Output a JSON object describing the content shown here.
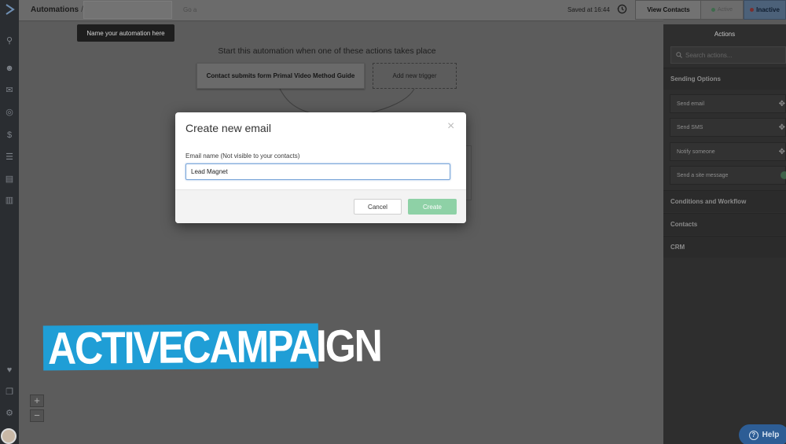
{
  "topbar": {
    "breadcrumb": "Automations",
    "breadcrumb_sep": "/",
    "name_input_value": "",
    "go_label": "Go a",
    "saved_text": "Saved at 16:44",
    "view_contacts_label": "View Contacts",
    "status_active_label": "Active",
    "status_inactive_label": "Inactive",
    "status_active_color": "#3f6b4c",
    "status_inactive_color": "#7a2f2f"
  },
  "canvas": {
    "tooltip": "Name your automation here",
    "start_text": "Start this automation when one of these actions takes place",
    "trigger_label": "Contact submits form Primal Video Method Guide",
    "add_trigger_label": "Add new trigger",
    "zoom_in": "+",
    "zoom_out": "−"
  },
  "panel": {
    "title": "Actions",
    "search_placeholder": "Search actions...",
    "sections": {
      "sending": "Sending Options",
      "conditions": "Conditions and Workflow",
      "contacts": "Contacts",
      "crm": "CRM"
    },
    "items": [
      {
        "label": "Send email",
        "icon": "move-icon"
      },
      {
        "label": "Send SMS",
        "icon": "move-icon"
      },
      {
        "label": "Notify someone",
        "icon": "move-icon"
      },
      {
        "label": "Send a site message",
        "icon": "new-badge"
      }
    ]
  },
  "modal": {
    "title": "Create new email",
    "close_glyph": "×",
    "field_label": "Email name (Not visible to your contacts)",
    "field_value": "Lead Magnet",
    "cancel_label": "Cancel",
    "create_label": "Create",
    "create_color": "#8ed1a6"
  },
  "help": {
    "label": "Help",
    "glyph": "?"
  },
  "watermark": {
    "text": "ACTIVECAMPAIGN",
    "color": "#1f9ed6"
  }
}
